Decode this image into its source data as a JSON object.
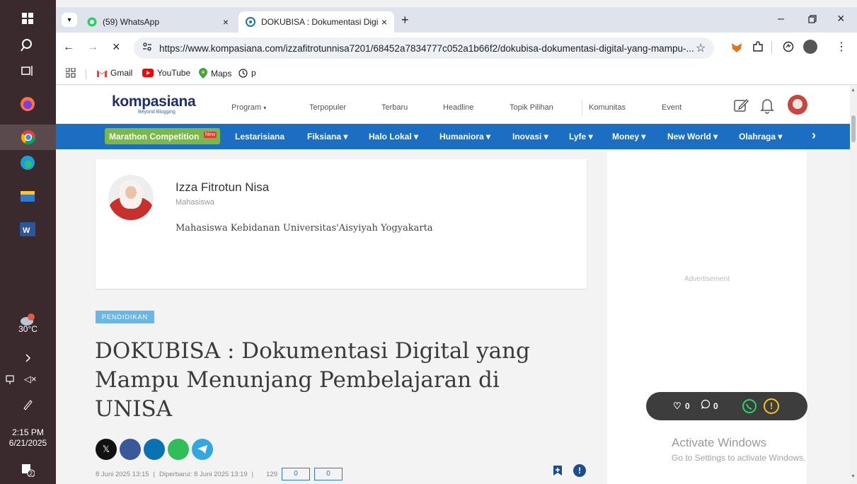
{
  "taskbar": {
    "weather_temp": "30°C",
    "weather_badge": "1",
    "time": "2:15 PM",
    "date": "6/21/2025",
    "notif_count": "2"
  },
  "browser": {
    "tabs": [
      {
        "title": "(59) WhatsApp",
        "close": "×"
      },
      {
        "title": "DOKUBISA : Dokumentasi Digit",
        "close": "×"
      }
    ],
    "new_tab": "+",
    "url": "https://www.kompasiana.com/izzafitrotunnisa7201/68452a7834777c052a1b66f2/dokubisa-dokumentasi-digital-yang-mampu-...",
    "bookmarks": [
      "Gmail",
      "YouTube",
      "Maps",
      "p"
    ]
  },
  "site": {
    "logo": "kompasiana",
    "tagline": "Beyond Blogging",
    "nav": [
      "Program",
      "Terpopuler",
      "Terbaru",
      "Headline",
      "Topik Pilihan",
      "Komunitas",
      "Event"
    ],
    "categories": {
      "marathon": "Marathon Competition",
      "new_badge": "New",
      "items": [
        "Lestarisiana",
        "Fiksiana ▾",
        "Halo Lokal ▾",
        "Humaniora ▾",
        "Inovasi ▾",
        "Lyfe ▾",
        "Money ▾",
        "New World ▾",
        "Olahraga ▾"
      ]
    }
  },
  "author": {
    "name": "Izza Fitrotun Nisa",
    "role": "Mahasiswa",
    "bio": "Mahasiswa Kebidanan Universitas'Aisyiyah Yogyakarta"
  },
  "sidebar": {
    "ad_label": "Advertisement"
  },
  "article": {
    "tag": "PENDIDIKAN",
    "title": "DOKUBISA : Dokumentasi Digital yang Mampu Menunjang Pembelajaran di UNISA",
    "published": "8 Juni 2025  13:15",
    "updated": "Diperbarui: 8 Juni 2025  13:19",
    "views": "129",
    "count1": "0",
    "count2": "0"
  },
  "floatbar": {
    "likes": "0",
    "comments": "0"
  },
  "watermark": {
    "line1": "Activate Windows",
    "line2": "Go to Settings to activate Windows."
  },
  "colors": {
    "brand_blue": "#1b6ec2",
    "marathon_green": "#7bb84a",
    "logo_navy": "#1e2f6b"
  }
}
